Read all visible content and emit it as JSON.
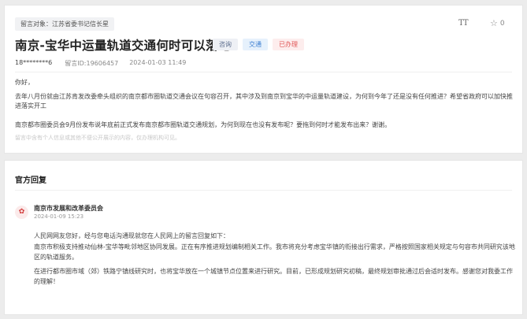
{
  "message": {
    "recipient": "留言对象：江苏省委书记信长星",
    "title": "南京-宝华中运量轨道交通何时可以落地",
    "tags": [
      "咨询",
      "交通",
      "已办理"
    ],
    "author": "18********6",
    "message_id": "留言ID:19606457",
    "time": "2024-01-03 11:49",
    "favorite_count": "0",
    "greeting": "你好，",
    "paragraph1": "去年八月份就由江苏肯发改委牵头组织的南京都市圈轨道交通会议在句容召开，其中涉及到南京到宝华的中运量轨道建设，为何到今年了还是没有任何推进？希望省政府可以加快推进落实开工",
    "paragraph2": "南京都市圈委员会9月份发布说年底前正式发布南京都市圈轨道交通规划，为何到现在也没有发布呢？要拖到何时才能发布出来？谢谢。",
    "disclaimer": "留言中含有个人信息或其他不便公开展示的内容，仅办理机构可见。"
  },
  "reply": {
    "section_title": "官方回复",
    "avatar_glyph": "✿",
    "department": "南京市发展和改革委员会",
    "date": "2024-01-09 15:23",
    "line1": "人民网网友您好，经与您电话沟通现就您在人民网上的留言回复如下：",
    "line2": "南京市积极支持推动仙林-宝华等毗邻地区协同发展。正在有序推进规划编制相关工作。我市将充分考虑宝华镇的衔接出行需求，严格按照国家相关规定与句容市共同研究该地区的轨道服务。",
    "line3": "在进行都市圈市域（郊）铁路宁镇线研究时，也将宝华放在一个城镇节点位置来进行研究。目前，已形成规划研究初稿，最终规划审批通过后会适时发布。感谢您对我委工作的理解！"
  },
  "icons": {
    "font_size": "TT",
    "star": "☆"
  },
  "colors": {
    "tag_red": "#e05555",
    "tag_blue": "#3d7fd1",
    "avatar_red": "#d23b3b"
  }
}
